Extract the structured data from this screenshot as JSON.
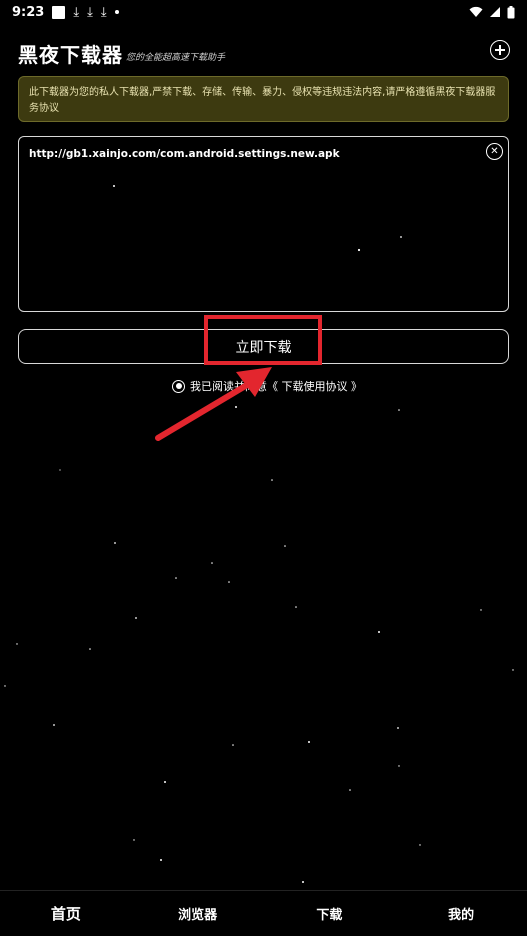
{
  "status_bar": {
    "time": "9:23",
    "download_icons": [
      "⤓",
      "⤓",
      "⤓"
    ]
  },
  "header": {
    "title": "黑夜下载器",
    "subtitle": "您的全能超高速下载助手"
  },
  "notice": {
    "text": "此下载器为您的私人下载器,严禁下载、存储、传输、暴力、侵权等违规违法内容,请严格遵循黑夜下载器服务协议"
  },
  "url_box": {
    "value": "http://gb1.xainjo.com/com.android.settings.new.apk"
  },
  "download_button": {
    "label": "立即下载"
  },
  "agreement": {
    "text": "我已阅读并同意《 下载使用协议 》"
  },
  "bottom_nav": {
    "items": [
      {
        "label": "首页"
      },
      {
        "label": "浏览器"
      },
      {
        "label": "下载"
      },
      {
        "label": "我的"
      }
    ]
  },
  "colors": {
    "background": "#000000",
    "notice_bg": "#3d3a10",
    "highlight": "#e3262e"
  }
}
